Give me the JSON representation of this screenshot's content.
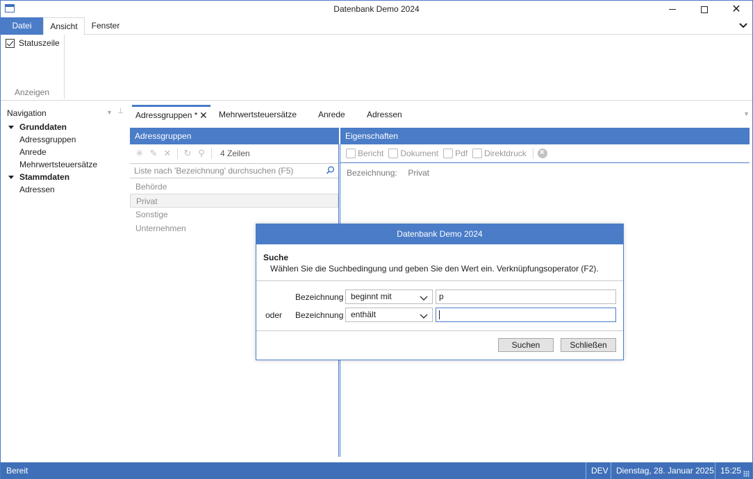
{
  "window": {
    "title": "Datenbank Demo 2024"
  },
  "ribbon": {
    "tabs": [
      "Datei",
      "Ansicht",
      "Fenster"
    ],
    "checkbox_label": "Statuszeile",
    "group_label": "Anzeigen"
  },
  "navigation": {
    "header": "Navigation",
    "groups": [
      {
        "label": "Grunddaten",
        "items": [
          "Adressgruppen",
          "Anrede",
          "Mehrwertsteuersätze"
        ]
      },
      {
        "label": "Stammdaten",
        "items": [
          "Adressen"
        ]
      }
    ]
  },
  "doc_tabs": [
    "Adressgruppen *",
    "Mehrwertsteuersätze",
    "Anrede",
    "Adressen"
  ],
  "left_panel": {
    "title": "Adressgruppen",
    "row_count": "4 Zeilen",
    "search_placeholder": "Liste nach 'Bezeichnung' durchsuchen (F5)",
    "rows": [
      "Behörde",
      "Privat",
      "Sonstige",
      "Unternehmen"
    ],
    "selected_index": 1
  },
  "right_panel": {
    "title": "Eigenschaften",
    "toolbar": [
      "Bericht",
      "Dokument",
      "Pdf",
      "Direktdruck"
    ],
    "property_label": "Bezeichnung:",
    "property_value": "Privat"
  },
  "dialog": {
    "title": "Datenbank Demo 2024",
    "heading": "Suche",
    "description": "Wählen Sie die Suchbedingung und geben Sie den Wert ein. Verknüpfungsoperator (F2).",
    "row1": {
      "field": "Bezeichnung",
      "condition": "beginnt mit",
      "value": "p"
    },
    "row2": {
      "operator": "oder",
      "field": "Bezeichnung",
      "condition": "enthält",
      "value": ""
    },
    "search_button": "Suchen",
    "close_button": "Schließen"
  },
  "statusbar": {
    "status": "Bereit",
    "env": "DEV",
    "date": "Dienstag, 28. Januar 2025",
    "time": "15:25"
  },
  "colors": {
    "accent": "#4a7cc7",
    "statusbar": "#3f6fb8"
  }
}
